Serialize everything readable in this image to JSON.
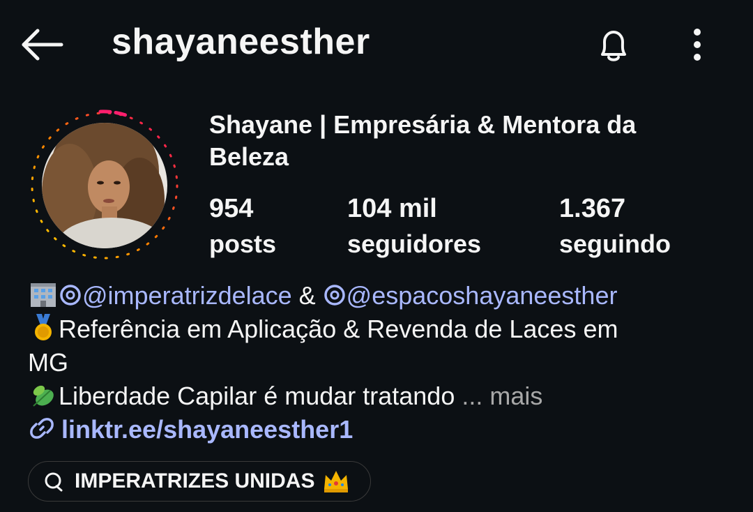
{
  "header": {
    "username": "shayaneesther",
    "back_icon": "arrow-left-icon",
    "notification_icon": "bell-icon",
    "menu_icon": "more-vertical-icon"
  },
  "profile": {
    "full_name": "Shayane | Empresária & Mentora da Beleza",
    "story_ring_colors": [
      "#ff0069",
      "#ff7a00",
      "#ffd600"
    ]
  },
  "stats": [
    {
      "value": "954",
      "label": "posts"
    },
    {
      "value": "104 mil",
      "label": "seguidores"
    },
    {
      "value": "1.367",
      "label": "seguindo"
    }
  ],
  "bio": {
    "line1_mention1": "@imperatrizdelace",
    "line1_sep": " & ",
    "line1_mention2": "@espacoshayaneesther",
    "line2": "Referência em Aplicação & Revenda de Laces em",
    "line3": "MG",
    "line4": "Liberdade Capilar é mudar tratando",
    "more": " ... mais",
    "link": "linktr.ee/shayaneesther1"
  },
  "channel": {
    "label": "IMPERATRIZES UNIDAS"
  }
}
